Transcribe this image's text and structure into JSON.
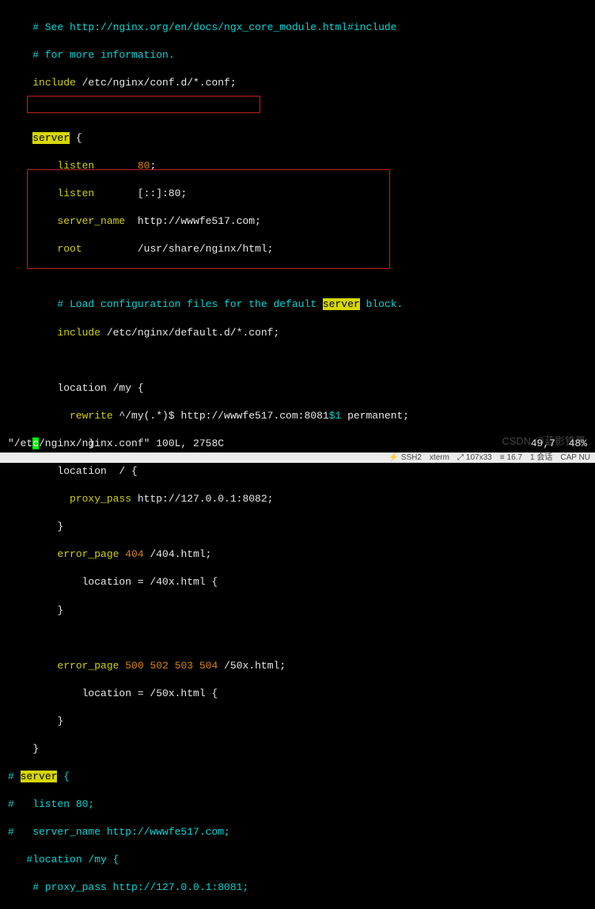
{
  "code": {
    "l1": {
      "a": "    # See http://nginx.org/en/docs/ngx_core_module.html#include"
    },
    "l2": {
      "a": "    # for more information."
    },
    "l3": {
      "a": "    ",
      "b": "include",
      "c": " /etc/nginx/conf.d/*.conf;"
    },
    "l5": {
      "a": "    ",
      "b": "server",
      "c": " {"
    },
    "l6": {
      "a": "        ",
      "b": "listen",
      "c": "       ",
      "d": "80",
      "e": ";"
    },
    "l7": {
      "a": "        ",
      "b": "listen",
      "c": "       [::]:80;"
    },
    "l8": {
      "a": "        ",
      "b": "server_name",
      "c": "  http://wwwfe517.com;"
    },
    "l9": {
      "a": "        ",
      "b": "root",
      "c": "         /usr/share/nginx/html;"
    },
    "l11": {
      "a": "        # Load configuration files for the default ",
      "b": "server",
      "c": " block."
    },
    "l12": {
      "a": "        ",
      "b": "include",
      "c": " /etc/nginx/default.d/*.conf;"
    },
    "l14": {
      "a": "        location /my {"
    },
    "l15": {
      "a": "          ",
      "b": "rewrite",
      "c": " ^/my(.*)$ http://wwwfe517.com:8081",
      "d": "$1",
      "e": " permanent;"
    },
    "l16": {
      "a": "        }"
    },
    "l17": {
      "a": "        location  / {"
    },
    "l18": {
      "a": "          ",
      "b": "proxy_pass",
      "c": " http://127.0.0.1:8082;"
    },
    "l19": {
      "a": "        }"
    },
    "l20": {
      "a": "        ",
      "b": "error_page",
      "c": " ",
      "d": "404",
      "e": " /404.html;"
    },
    "l21": {
      "a": "            location = /40x.html {"
    },
    "l22": {
      "a": "        }"
    },
    "l24": {
      "a": "        ",
      "b": "error_page",
      "c": " ",
      "d": "500",
      "e": " ",
      "f": "502",
      "g": " ",
      "h": "503",
      "i": " ",
      "j": "504",
      "k": " /50x.html;"
    },
    "l25": {
      "a": "            location = /50x.html {"
    },
    "l26": {
      "a": "        }"
    },
    "l27": {
      "a": "    }"
    },
    "l28": {
      "a": "# ",
      "b": "server",
      "c": " {"
    },
    "l29": {
      "a": "#   listen 80;"
    },
    "l30": {
      "a": "#   server_name http://wwwfe517.com;"
    },
    "l31": {
      "a": "   #location /my {"
    },
    "l32": {
      "a": "    # proxy_pass http://127.0.0.1:8081;"
    }
  },
  "status": {
    "file": "\"/etc/nginx/nginx.conf\" 100L, 2758C",
    "ruler": "49,7",
    "pct": "48%"
  },
  "watermark": "CSDN @蓝影铁哥",
  "bottombar": {
    "ssh": "SSH2",
    "term": "xterm",
    "size": "107x33",
    "enc": "16.7",
    "sess": "1 会话",
    "cap": "CAP  NU"
  }
}
